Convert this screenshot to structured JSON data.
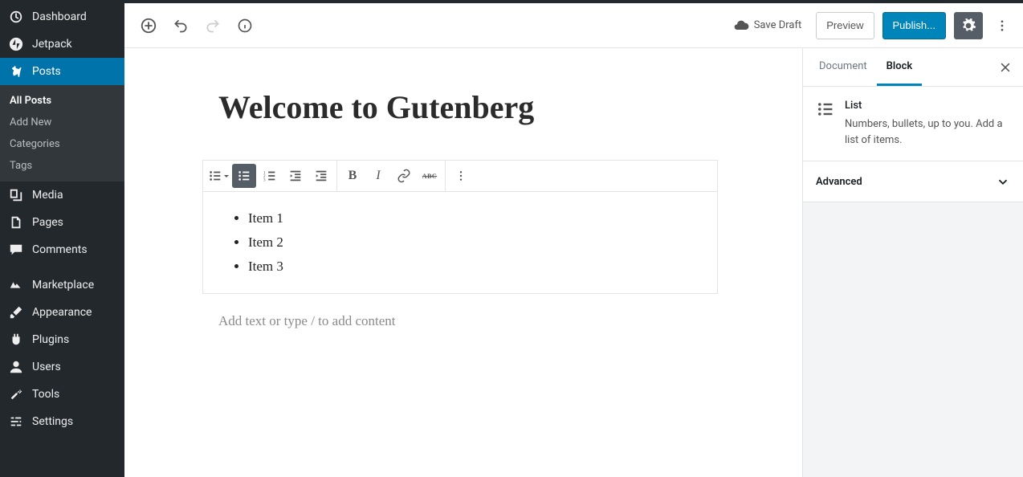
{
  "sidebar": {
    "dashboard": "Dashboard",
    "jetpack": "Jetpack",
    "posts": "Posts",
    "submenu": {
      "all_posts": "All Posts",
      "add_new": "Add New",
      "categories": "Categories",
      "tags": "Tags"
    },
    "media": "Media",
    "pages": "Pages",
    "comments": "Comments",
    "marketplace": "Marketplace",
    "appearance": "Appearance",
    "plugins": "Plugins",
    "users": "Users",
    "tools": "Tools",
    "settings": "Settings"
  },
  "toolbar": {
    "save_draft": "Save Draft",
    "preview": "Preview",
    "publish": "Publish..."
  },
  "post": {
    "title": "Welcome to Gutenberg",
    "list_items": [
      "Item 1",
      "Item 2",
      "Item 3"
    ],
    "appender_placeholder": "Add text or type / to add content"
  },
  "inspector": {
    "tab_document": "Document",
    "tab_block": "Block",
    "block_title": "List",
    "block_desc": "Numbers, bullets, up to you. Add a list of items.",
    "advanced": "Advanced"
  },
  "colors": {
    "accent": "#0085ba",
    "sidebar_bg": "#23282d"
  }
}
